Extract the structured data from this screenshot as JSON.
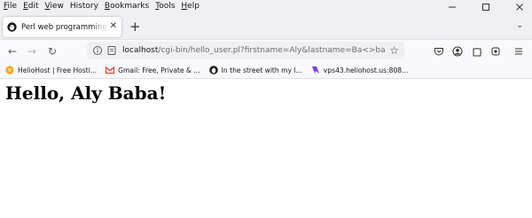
{
  "menubar": {
    "items": [
      {
        "accel": "F",
        "rest": "ile"
      },
      {
        "accel": "E",
        "rest": "dit"
      },
      {
        "accel": "V",
        "rest": "iew"
      },
      {
        "accel": "",
        "rest": "History",
        "accel_inner": "s"
      },
      {
        "accel": "B",
        "rest": "ookmarks"
      },
      {
        "accel": "T",
        "rest": "ools"
      },
      {
        "accel": "H",
        "rest": "elp"
      }
    ]
  },
  "tab": {
    "title": "Perl web programming (Perl scr",
    "close_glyph": "✕"
  },
  "tabstrip": {
    "new_tab_glyph": "+",
    "list_glyph": "⌄"
  },
  "window_controls": {
    "minimize": "—",
    "maximize": "☐",
    "close": "✕"
  },
  "navbar": {
    "back_glyph": "←",
    "forward_glyph": "→",
    "reload_glyph": "↻",
    "url_host": "localhost",
    "url_rest": "/cgi-bin/hello_user.pl?firstname=Aly&lastname=Ba<>ba",
    "star_glyph": "☆"
  },
  "bookmarks": {
    "items": [
      {
        "label": "HelioHost | Free Hosti...",
        "icon": "heliohost-icon"
      },
      {
        "label": "Gmail: Free, Private & ...",
        "icon": "gmail-icon"
      },
      {
        "label": "In the street with my l...",
        "icon": "profile-icon"
      },
      {
        "label": "vps43.heliohost.us:808...",
        "icon": "vps-icon"
      }
    ]
  },
  "page": {
    "heading": "Hello, Aly Baba!"
  },
  "colors": {
    "chrome_bg": "#f0f0f4",
    "toolbar_bg": "#f9f9fb",
    "text": "#15141a",
    "gmail_red": "#d93025",
    "helio_orange": "#f5a623",
    "vps_purple": "#7b3fe4"
  }
}
